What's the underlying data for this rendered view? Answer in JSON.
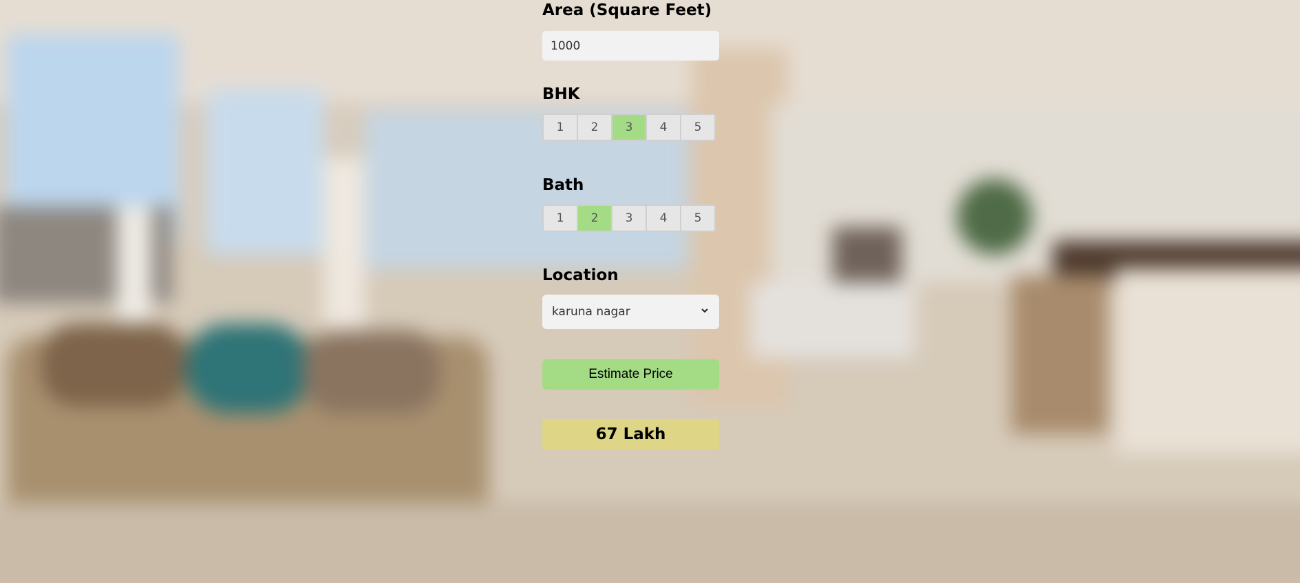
{
  "area": {
    "label": "Area (Square Feet)",
    "value": "1000"
  },
  "bhk": {
    "label": "BHK",
    "options": [
      "1",
      "2",
      "3",
      "4",
      "5"
    ],
    "selected": "3"
  },
  "bath": {
    "label": "Bath",
    "options": [
      "1",
      "2",
      "3",
      "4",
      "5"
    ],
    "selected": "2"
  },
  "location": {
    "label": "Location",
    "selected_value": "karuna nagar"
  },
  "estimate_button": {
    "label": "Estimate Price"
  },
  "result": {
    "text": "67 Lakh"
  },
  "colors": {
    "selected_option": "#a4dc86",
    "button": "#a4dc86",
    "result_background": "#dfd587",
    "input_background": "#f2f2f2"
  },
  "icons": {
    "select_arrow": "chevron-down-icon"
  }
}
